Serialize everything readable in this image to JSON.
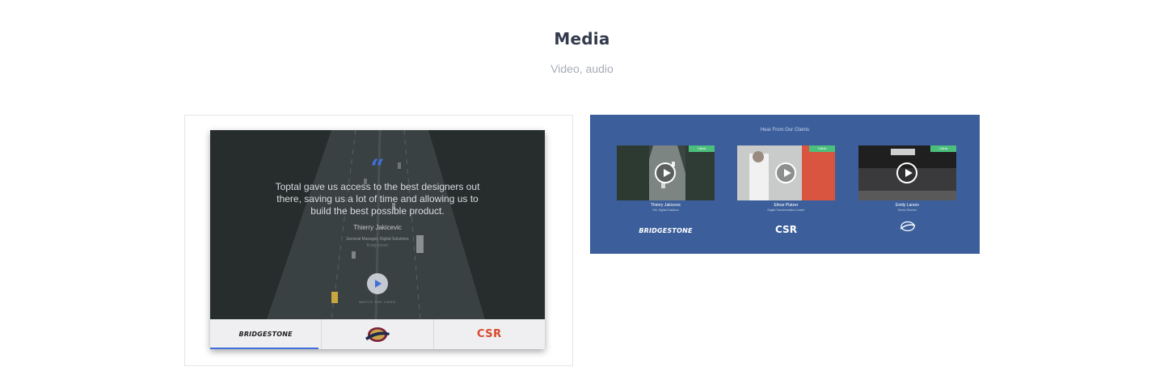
{
  "header": {
    "title": "Media",
    "subtitle": "Video, audio"
  },
  "testimonial": {
    "quote_mark": "“",
    "quote": "Toptal gave us access to the best designers out there, saving us a lot of time and allowing us to build the best possible product.",
    "name": "Thierry Jakicevic",
    "role": "General Manager, Digital Solutions",
    "company": "Bridgestone",
    "watch_label": "WATCH THE VIDEO",
    "logos": [
      {
        "name": "BRIDGESTONE",
        "active": true
      },
      {
        "name": "Cavaliers",
        "active": false
      },
      {
        "name": "CSR",
        "active": false
      }
    ]
  },
  "clients_panel": {
    "heading": "Hear From Our Clients",
    "badge": "Client",
    "clients": [
      {
        "name": "Thierry Jakicevic",
        "role": "GM, Digital Solutions",
        "logo": "BRIDGESTONE"
      },
      {
        "name": "Elmar Platzer",
        "role": "Digital Transformation Leader",
        "logo": "CSR"
      },
      {
        "name": "Emily Larson",
        "role": "Senior Director",
        "logo": "Cavaliers"
      }
    ]
  },
  "colors": {
    "accent_blue": "#3f6fd8",
    "panel_blue": "#3c5f9c",
    "badge_green": "#4cbf7d",
    "csr_red": "#d9472b"
  },
  "icons": [
    "play-icon",
    "quote-icon",
    "bridgestone-logo",
    "cavaliers-logo",
    "csr-logo"
  ]
}
